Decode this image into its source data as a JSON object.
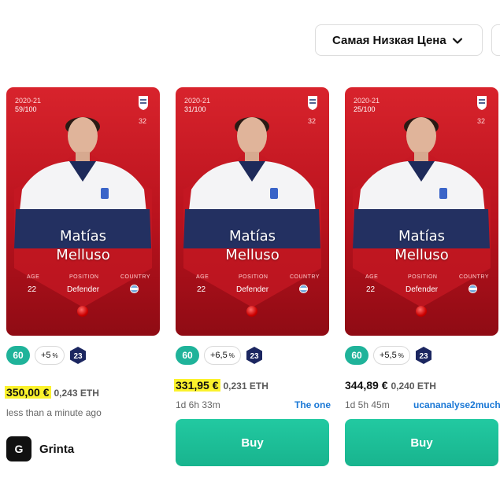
{
  "sort": {
    "label": "Самая Низкая Цена"
  },
  "cards": [
    {
      "season": "2020-21",
      "serial": "59/100",
      "shirt_number": "32",
      "first_name": "Matías",
      "last_name": "Melluso",
      "age_label": "AGE",
      "position_label": "POSITION",
      "country_label": "COUNTRY",
      "age": "22",
      "position": "Defender",
      "score": "60",
      "bonus": "+5",
      "bonus_unit": "%",
      "level": "23",
      "price_eur": "350,00 €",
      "price_eth": "0,243 ETH",
      "price_highlighted": true,
      "time": "less than a minute ago",
      "seller": ""
    },
    {
      "season": "2020-21",
      "serial": "31/100",
      "shirt_number": "32",
      "first_name": "Matías",
      "last_name": "Melluso",
      "age_label": "AGE",
      "position_label": "POSITION",
      "country_label": "COUNTRY",
      "age": "22",
      "position": "Defender",
      "score": "60",
      "bonus": "+6,5",
      "bonus_unit": "%",
      "level": "23",
      "price_eur": "331,95 €",
      "price_eth": "0,231 ETH",
      "price_highlighted": true,
      "time": "1d 6h 33m",
      "seller": "The one",
      "buy_label": "Buy"
    },
    {
      "season": "2020-21",
      "serial": "25/100",
      "shirt_number": "32",
      "first_name": "Matías",
      "last_name": "Melluso",
      "age_label": "AGE",
      "position_label": "POSITION",
      "country_label": "COUNTRY",
      "age": "22",
      "position": "Defender",
      "score": "60",
      "bonus": "+5,5",
      "bonus_unit": "%",
      "level": "23",
      "price_eur": "344,89 €",
      "price_eth": "0,240 ETH",
      "price_highlighted": false,
      "time": "1d 5h 45m",
      "seller": "ucananalyse2much",
      "buy_label": "Buy"
    }
  ],
  "owner": {
    "initial": "G",
    "name": "Grinta"
  },
  "colors": {
    "card_red": "#c8161f",
    "score_teal": "#1fb39a",
    "buy_green": "#1dbf96",
    "seller_blue": "#1a78d6",
    "highlight": "#fbf22c",
    "level_navy": "#1b2660"
  },
  "icons": {
    "dropdown": "chevron-down-icon",
    "club": "club-crest-icon",
    "flag": "argentina-flag-icon",
    "ball": "ball-icon",
    "level": "level-hexagon-icon"
  }
}
